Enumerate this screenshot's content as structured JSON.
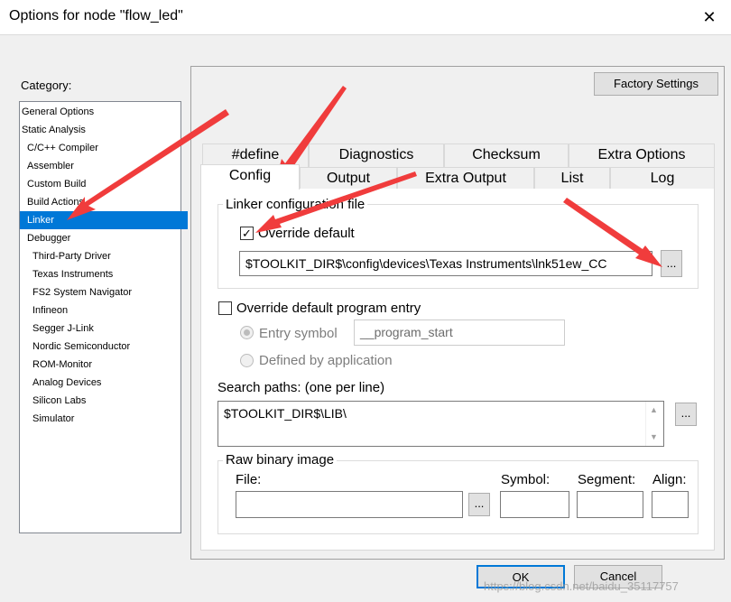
{
  "window": {
    "title": "Options for node \"flow_led\"",
    "close_glyph": "✕"
  },
  "category": {
    "label": "Category:",
    "items": [
      "General Options",
      "Static Analysis",
      "C/C++ Compiler",
      "Assembler",
      "Custom Build",
      "Build Actions",
      "Linker",
      "Debugger",
      "Third-Party Driver",
      "Texas Instruments",
      "FS2 System Navigator",
      "Infineon",
      "Segger J-Link",
      "Nordic Semiconductor",
      "ROM-Monitor",
      "Analog Devices",
      "Silicon Labs",
      "Simulator"
    ],
    "selected": "Linker"
  },
  "factory_settings": "Factory Settings",
  "tabs": {
    "row1": [
      "#define",
      "Diagnostics",
      "Checksum",
      "Extra Options"
    ],
    "row2": [
      "Config",
      "Output",
      "Extra Output",
      "List",
      "Log"
    ],
    "active": "Config"
  },
  "linker_config": {
    "group_title": "Linker configuration file",
    "override_label": "Override default",
    "override_checked": true,
    "path_value": "$TOOLKIT_DIR$\\config\\devices\\Texas Instruments\\lnk51ew_CC",
    "browse_label": "..."
  },
  "entry": {
    "override_label": "Override default program entry",
    "override_checked": false,
    "entry_symbol_label": "Entry symbol",
    "entry_symbol_value": "__program_start",
    "defined_by_app_label": "Defined by application"
  },
  "search": {
    "label": "Search paths:  (one per line)",
    "value": "$TOOLKIT_DIR$\\LIB\\",
    "browse_label": "..."
  },
  "raw_binary": {
    "group_title": "Raw binary image",
    "file_label": "File:",
    "symbol_label": "Symbol:",
    "segment_label": "Segment:",
    "align_label": "Align:",
    "browse_label": "..."
  },
  "buttons": {
    "ok": "OK",
    "cancel": "Cancel"
  },
  "watermark": "https://blog.csdn.net/baidu_35117757",
  "accent_color": "#0078d7",
  "annotation_color": "#f03c3c"
}
